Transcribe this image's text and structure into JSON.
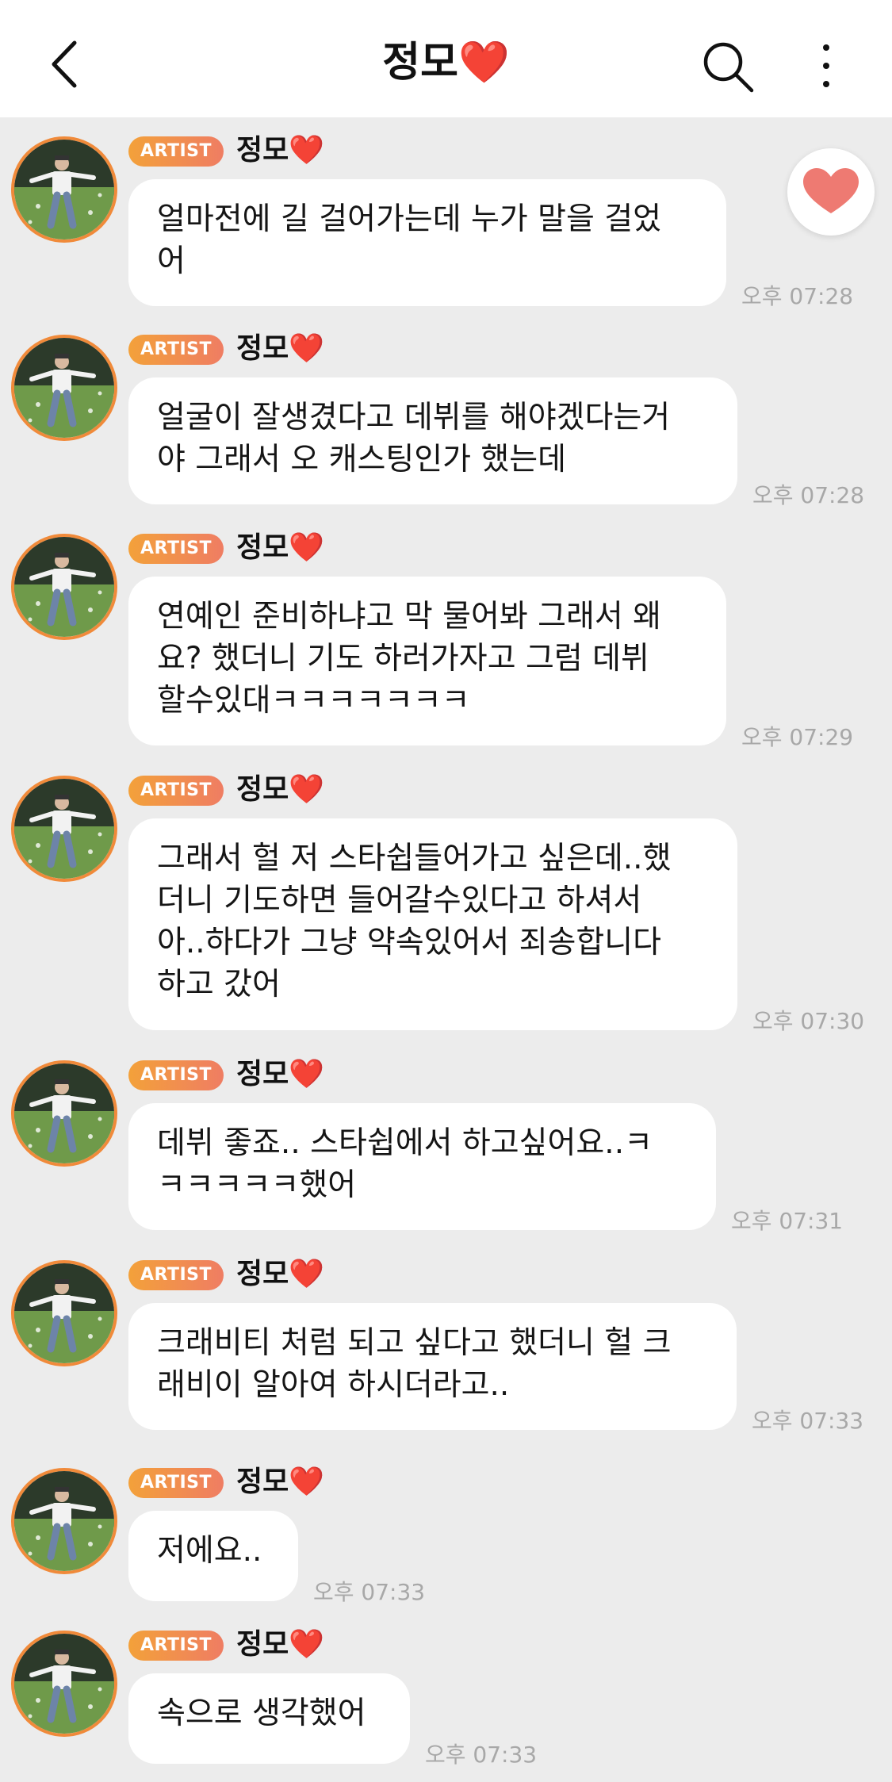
{
  "header": {
    "title": "정모",
    "title_emoji": "❤️"
  },
  "sender": {
    "badge": "ARTIST",
    "name": "정모",
    "name_emoji": "❤️"
  },
  "messages": [
    {
      "text": "얼마전에 길 걸어가는데 누가 말을 걸었\n어",
      "time": "오후 07:28"
    },
    {
      "text": "얼굴이 잘생겼다고 데뷔를 해야겠다는거\n야 그래서 오 캐스팅인가 했는데",
      "time": "오후 07:28"
    },
    {
      "text": "연예인 준비하냐고 막 물어봐 그래서 왜\n요? 했더니 기도 하러가자고 그럼 데뷔\n할수있대ㅋㅋㅋㅋㅋㅋㅋ",
      "time": "오후 07:29"
    },
    {
      "text": "그래서 헐 저 스타쉽들어가고 싶은데..했\n더니 기도하면 들어갈수있다고 하셔서\n아..하다가 그냥 약속있어서 죄송합니다\n하고 갔어",
      "time": "오후 07:30"
    },
    {
      "text": "데뷔 좋죠.. 스타쉽에서 하고싶어요..ㅋ\nㅋㅋㅋㅋㅋ했어",
      "time": "오후 07:31"
    },
    {
      "text": "크래비티 처럼 되고 싶다고 했더니 헐 크\n래비이 알아여 하시더라고..",
      "time": "오후 07:33"
    },
    {
      "text": "저에요..",
      "time": "오후 07:33"
    },
    {
      "text": "속으로 생각했어",
      "time": "오후 07:33"
    }
  ],
  "colors": {
    "background": "#ececec",
    "badge_start": "#f3a13a",
    "badge_end": "#ef7d63",
    "heart": "#e8262b",
    "avatar_ring": "#f08a3a"
  },
  "icons": [
    "back-arrow-icon",
    "search-icon",
    "more-vertical-icon",
    "heart-reaction-icon"
  ]
}
